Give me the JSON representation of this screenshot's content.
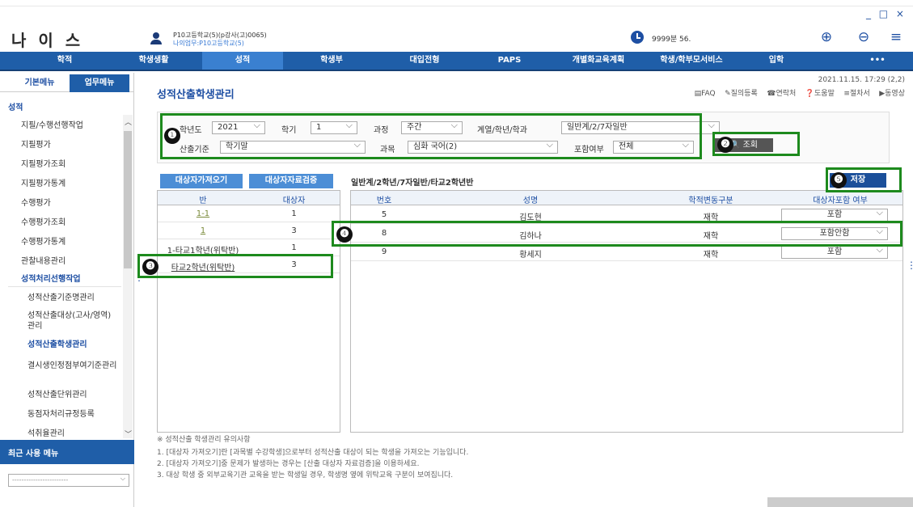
{
  "window": {
    "controls": "_ □ ×"
  },
  "header": {
    "logo": "나 이 스",
    "user_name": "P10고등학교(5)(p강사(고)0065)",
    "user_duty": "나의업무:P10고등학교(5)",
    "timer": "9999분 56.",
    "icons": [
      "zoom-in-icon",
      "zoom-out-icon",
      "hamburger-menu-icon"
    ]
  },
  "menu": [
    "학적",
    "학생생활",
    "성적",
    "학생부",
    "대입전형",
    "PAPS",
    "개별화교육계획",
    "학생/학부모서비스",
    "입학",
    "•••"
  ],
  "menu_active": "성적",
  "sidebar": {
    "tabs": [
      "기본메뉴",
      "업무메뉴"
    ],
    "category": "성적",
    "items": [
      "지필/수행선행작업",
      "지필평가",
      "지필평가조회",
      "지필평가통계",
      "수행평가",
      "수행평가조회",
      "수행평가통계",
      "관찰내용관리",
      "성적처리선행작업"
    ],
    "subitems": [
      "성적산출기준명관리",
      "성적산출대상(고사/영역)관리",
      "성적산출학생관리",
      "결시생인정점부여기준관리",
      "성적산출단위관리",
      "동점자처리규정등록",
      "석취율관리"
    ],
    "recent_label": "최근 사용 메뉴",
    "recent_placeholder": "------------------------"
  },
  "page": {
    "title": "성적산출학생관리",
    "datetime": "2021.11.15. 17:29 (2,2)",
    "help_links": [
      "▤FAQ",
      "✎질의등록",
      "☎연락처",
      "❓도움말",
      "≡절차서",
      "▶동영상"
    ]
  },
  "filters": {
    "year_label": "학년도",
    "year": "2021",
    "term_label": "학기",
    "term": "1",
    "course_label": "과정",
    "course": "주간",
    "dept_label": "계열/학년/학과",
    "dept": "일반계/2/7자일반",
    "basis_label": "산출기준",
    "basis": "학기말",
    "subject_label": "과목",
    "subject": "심화 국어(2)",
    "include_label": "포함여부",
    "include": "전체",
    "search_button": "조회"
  },
  "buttons": {
    "fetch": "대상자가져오기",
    "verify": "대상자자료검증",
    "save": "저장"
  },
  "class_table": {
    "headers": [
      "반",
      "대상자"
    ],
    "rows": [
      {
        "class": "1-1",
        "count": "1"
      },
      {
        "class": "1",
        "count": "3"
      },
      {
        "class": "1-타교1학년(위탁반)",
        "count": "1"
      },
      {
        "class": "타교2학년(위탁반)",
        "count": "3"
      }
    ]
  },
  "student_table": {
    "title": "일반계/2학년/7자일반/타교2학년반",
    "headers": [
      "번호",
      "성명",
      "학적변동구분",
      "대상자포함 여부"
    ],
    "rows": [
      {
        "no": "5",
        "name": "김도현",
        "status": "재학",
        "include": "포함"
      },
      {
        "no": "8",
        "name": "김하나",
        "status": "재학",
        "include": "포함안함"
      },
      {
        "no": "9",
        "name": "황세지",
        "status": "재학",
        "include": "포함"
      }
    ]
  },
  "notes": {
    "title": "※ 성적산출 학생관리 유의사항",
    "lines": [
      "1. [대상자 가져오기]란 [과목별 수강학생]으로부터 성적산출 대상이 되는 학생을 가져오는 기능입니다.",
      "2. [대상자 가져오기]중 문제가 발생하는 경우는 [산출 대상자 자료검증]을 이용하세요.",
      "3. 대상 학생 중 외부교육기관 교육을 받는 학생일 경우, 학생명 옆에 위탁교육 구분이 보여집니다."
    ]
  },
  "markers": [
    "❶",
    "❷",
    "❸",
    "❹",
    "❺"
  ]
}
